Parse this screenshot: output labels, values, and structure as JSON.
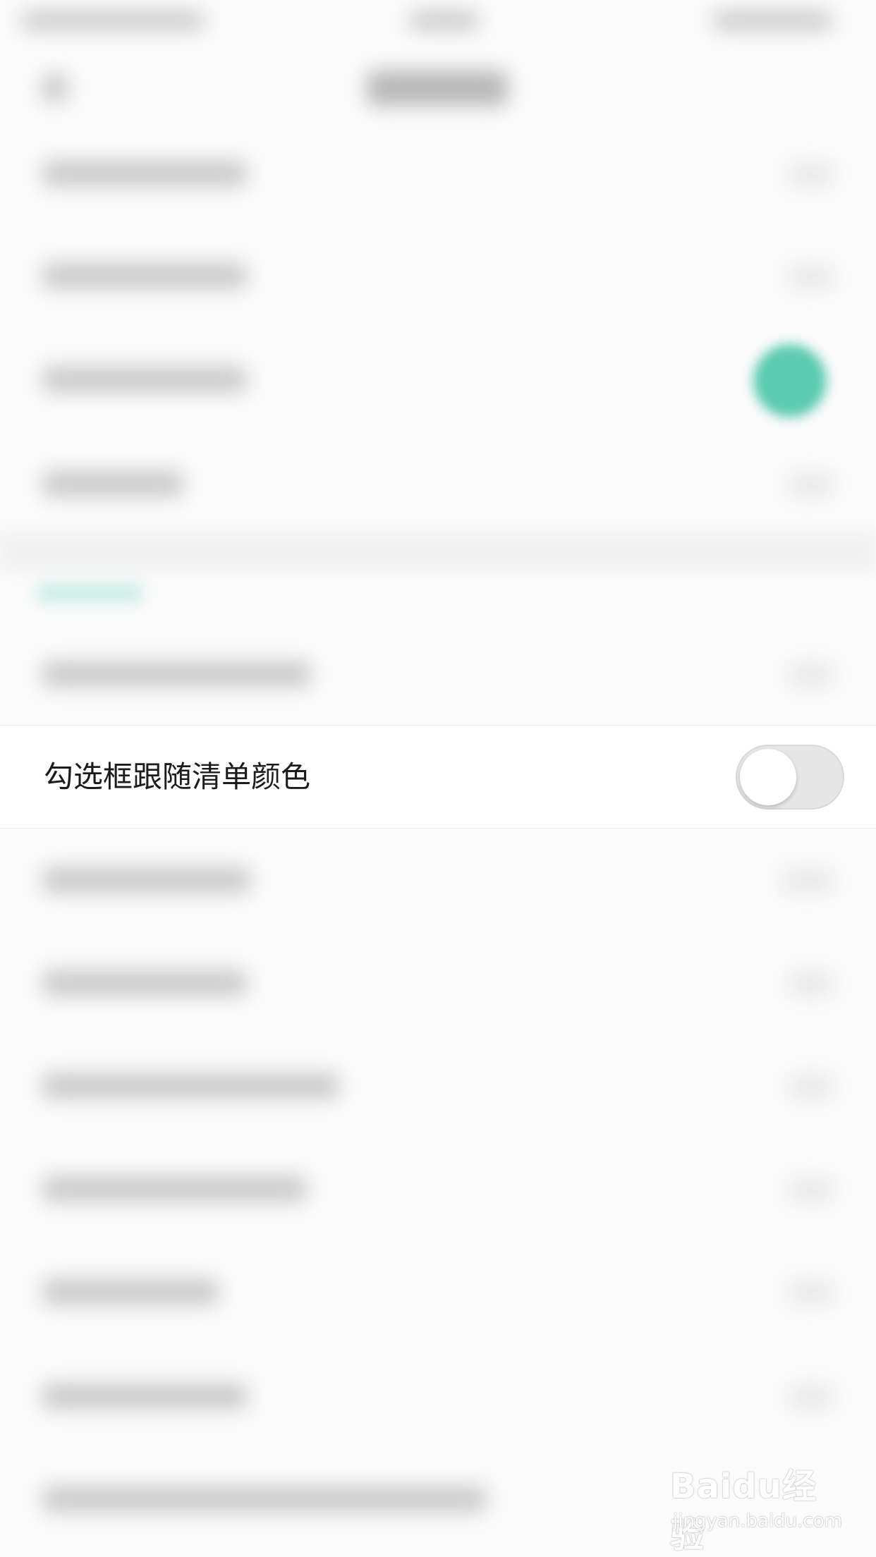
{
  "setting_row": {
    "label": "勾选框跟随清单颜色",
    "toggle_state": "off"
  },
  "watermark": {
    "logo": "Baidu经验",
    "url": "jingyan.baidu.com"
  },
  "colors": {
    "background": "#fbfbfb",
    "accent_green": "#5ccbb0",
    "toggle_off": "#e6e6e6"
  }
}
